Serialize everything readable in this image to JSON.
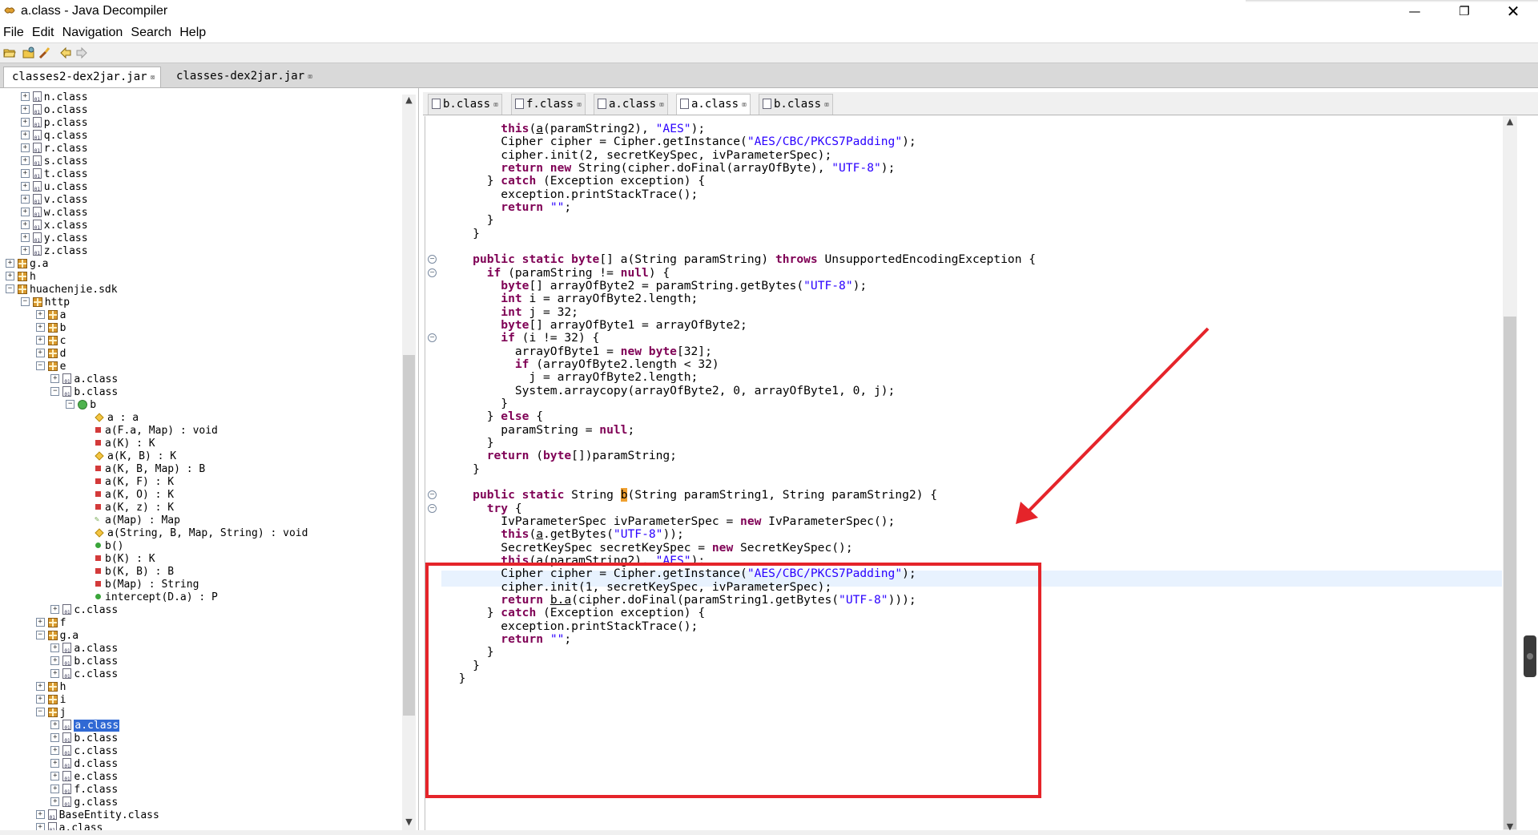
{
  "window": {
    "title": "a.class - Java Decompiler"
  },
  "menu": [
    "File",
    "Edit",
    "Navigation",
    "Search",
    "Help"
  ],
  "toolbar": {
    "icons": [
      "open-file-icon",
      "open-type-icon",
      "search-icon",
      "back-arrow-icon",
      "forward-arrow-icon"
    ]
  },
  "jar_tabs": [
    {
      "label": "classes2-dex2jar.jar",
      "active": true
    },
    {
      "label": "classes-dex2jar.jar",
      "active": false
    }
  ],
  "tree": [
    {
      "label": "n.class",
      "indent": 2,
      "type": "file",
      "exp": "+"
    },
    {
      "label": "o.class",
      "indent": 2,
      "type": "file",
      "exp": "+"
    },
    {
      "label": "p.class",
      "indent": 2,
      "type": "file",
      "exp": "+"
    },
    {
      "label": "q.class",
      "indent": 2,
      "type": "file",
      "exp": "+"
    },
    {
      "label": "r.class",
      "indent": 2,
      "type": "file",
      "exp": "+"
    },
    {
      "label": "s.class",
      "indent": 2,
      "type": "file",
      "exp": "+"
    },
    {
      "label": "t.class",
      "indent": 2,
      "type": "file",
      "exp": "+"
    },
    {
      "label": "u.class",
      "indent": 2,
      "type": "file",
      "exp": "+"
    },
    {
      "label": "v.class",
      "indent": 2,
      "type": "file",
      "exp": "+"
    },
    {
      "label": "w.class",
      "indent": 2,
      "type": "file",
      "exp": "+"
    },
    {
      "label": "x.class",
      "indent": 2,
      "type": "file",
      "exp": "+"
    },
    {
      "label": "y.class",
      "indent": 2,
      "type": "file",
      "exp": "+"
    },
    {
      "label": "z.class",
      "indent": 2,
      "type": "file",
      "exp": "+"
    },
    {
      "label": "g.a",
      "indent": 1,
      "type": "pkg",
      "exp": "+"
    },
    {
      "label": "h",
      "indent": 1,
      "type": "pkg",
      "exp": "+"
    },
    {
      "label": "huachenjie.sdk",
      "indent": 1,
      "type": "pkg",
      "exp": "-"
    },
    {
      "label": "http",
      "indent": 2,
      "type": "pkg",
      "exp": "-"
    },
    {
      "label": "a",
      "indent": 3,
      "type": "pkg",
      "exp": "+"
    },
    {
      "label": "b",
      "indent": 3,
      "type": "pkg",
      "exp": "+"
    },
    {
      "label": "c",
      "indent": 3,
      "type": "pkg",
      "exp": "+"
    },
    {
      "label": "d",
      "indent": 3,
      "type": "pkg",
      "exp": "+"
    },
    {
      "label": "e",
      "indent": 3,
      "type": "pkg",
      "exp": "-"
    },
    {
      "label": "a.class",
      "indent": 4,
      "type": "file",
      "exp": "+"
    },
    {
      "label": "b.class",
      "indent": 4,
      "type": "file",
      "exp": "-"
    },
    {
      "label": "b",
      "indent": 5,
      "type": "class",
      "exp": "-"
    },
    {
      "label": "a : a",
      "indent": 6,
      "type": "diamond",
      "exp": ""
    },
    {
      "label": "a(F.a, Map) : void",
      "indent": 6,
      "type": "red",
      "exp": ""
    },
    {
      "label": "a(K) : K",
      "indent": 6,
      "type": "red",
      "exp": ""
    },
    {
      "label": "a(K, B) : K",
      "indent": 6,
      "type": "diamond",
      "exp": ""
    },
    {
      "label": "a(K, B, Map) : B",
      "indent": 6,
      "type": "red",
      "exp": ""
    },
    {
      "label": "a(K, F) : K",
      "indent": 6,
      "type": "red",
      "exp": ""
    },
    {
      "label": "a(K, O) : K",
      "indent": 6,
      "type": "red",
      "exp": ""
    },
    {
      "label": "a(K, z) : K",
      "indent": 6,
      "type": "red",
      "exp": ""
    },
    {
      "label": "a(Map) : Map",
      "indent": 6,
      "type": "pen",
      "exp": ""
    },
    {
      "label": "a(String, B, Map, String) : void",
      "indent": 6,
      "type": "diamond",
      "exp": ""
    },
    {
      "label": "b()",
      "indent": 6,
      "type": "green",
      "exp": ""
    },
    {
      "label": "b(K) : K",
      "indent": 6,
      "type": "red",
      "exp": ""
    },
    {
      "label": "b(K, B) : B",
      "indent": 6,
      "type": "red",
      "exp": ""
    },
    {
      "label": "b(Map) : String",
      "indent": 6,
      "type": "red",
      "exp": ""
    },
    {
      "label": "intercept(D.a) : P",
      "indent": 6,
      "type": "green",
      "exp": ""
    },
    {
      "label": "c.class",
      "indent": 4,
      "type": "file",
      "exp": "+"
    },
    {
      "label": "f",
      "indent": 3,
      "type": "pkg",
      "exp": "+"
    },
    {
      "label": "g.a",
      "indent": 3,
      "type": "pkg",
      "exp": "-"
    },
    {
      "label": "a.class",
      "indent": 4,
      "type": "file",
      "exp": "+"
    },
    {
      "label": "b.class",
      "indent": 4,
      "type": "file",
      "exp": "+"
    },
    {
      "label": "c.class",
      "indent": 4,
      "type": "file",
      "exp": "+"
    },
    {
      "label": "h",
      "indent": 3,
      "type": "pkg",
      "exp": "+"
    },
    {
      "label": "i",
      "indent": 3,
      "type": "pkg",
      "exp": "+"
    },
    {
      "label": "j",
      "indent": 3,
      "type": "pkg",
      "exp": "-"
    },
    {
      "label": "a.class",
      "indent": 4,
      "type": "file",
      "exp": "+",
      "selected": true
    },
    {
      "label": "b.class",
      "indent": 4,
      "type": "file",
      "exp": "+"
    },
    {
      "label": "c.class",
      "indent": 4,
      "type": "file",
      "exp": "+"
    },
    {
      "label": "d.class",
      "indent": 4,
      "type": "file",
      "exp": "+"
    },
    {
      "label": "e.class",
      "indent": 4,
      "type": "file",
      "exp": "+"
    },
    {
      "label": "f.class",
      "indent": 4,
      "type": "file",
      "exp": "+"
    },
    {
      "label": "g.class",
      "indent": 4,
      "type": "file",
      "exp": "+"
    },
    {
      "label": "BaseEntity.class",
      "indent": 3,
      "type": "file",
      "exp": "+"
    },
    {
      "label": "a.class",
      "indent": 3,
      "type": "file",
      "exp": "+"
    }
  ],
  "editor_tabs": [
    {
      "label": "b.class",
      "active": false
    },
    {
      "label": "f.class",
      "active": false
    },
    {
      "label": "a.class",
      "active": false
    },
    {
      "label": "a.class",
      "active": true
    },
    {
      "label": "b.class",
      "active": false
    }
  ],
  "code_lines": [
    [
      [
        "p",
        "        "
      ],
      [
        "k",
        "this"
      ],
      [
        "p",
        "("
      ],
      [
        "u",
        "a"
      ],
      [
        "p",
        "(paramString2), "
      ],
      [
        "s",
        "\"AES\""
      ],
      [
        "p",
        ");"
      ]
    ],
    [
      [
        "p",
        "        Cipher cipher = Cipher.getInstance("
      ],
      [
        "s",
        "\"AES/CBC/PKCS7Padding\""
      ],
      [
        "p",
        ");"
      ]
    ],
    [
      [
        "p",
        "        cipher.init(2, secretKeySpec, ivParameterSpec);"
      ]
    ],
    [
      [
        "p",
        "        "
      ],
      [
        "k",
        "return new"
      ],
      [
        "p",
        " String(cipher.doFinal(arrayOfByte), "
      ],
      [
        "s",
        "\"UTF-8\""
      ],
      [
        "p",
        ");"
      ]
    ],
    [
      [
        "p",
        "      } "
      ],
      [
        "k",
        "catch"
      ],
      [
        "p",
        " (Exception exception) {"
      ]
    ],
    [
      [
        "p",
        "        exception.printStackTrace();"
      ]
    ],
    [
      [
        "p",
        "        "
      ],
      [
        "k",
        "return"
      ],
      [
        "p",
        " "
      ],
      [
        "s",
        "\"\""
      ],
      [
        "p",
        ";"
      ]
    ],
    [
      [
        "p",
        "      }"
      ]
    ],
    [
      [
        "p",
        "    }"
      ]
    ],
    [
      [
        "p",
        ""
      ]
    ],
    [
      [
        "p",
        "    "
      ],
      [
        "k",
        "public static byte"
      ],
      [
        "p",
        "[] a(String paramString) "
      ],
      [
        "k",
        "throws"
      ],
      [
        "p",
        " UnsupportedEncodingException {"
      ]
    ],
    [
      [
        "p",
        "      "
      ],
      [
        "k",
        "if"
      ],
      [
        "p",
        " (paramString != "
      ],
      [
        "k",
        "null"
      ],
      [
        "p",
        ") {"
      ]
    ],
    [
      [
        "p",
        "        "
      ],
      [
        "k",
        "byte"
      ],
      [
        "p",
        "[] arrayOfByte2 = paramString.getBytes("
      ],
      [
        "s",
        "\"UTF-8\""
      ],
      [
        "p",
        ");"
      ]
    ],
    [
      [
        "p",
        "        "
      ],
      [
        "k",
        "int"
      ],
      [
        "p",
        " i = arrayOfByte2.length;"
      ]
    ],
    [
      [
        "p",
        "        "
      ],
      [
        "k",
        "int"
      ],
      [
        "p",
        " j = 32;"
      ]
    ],
    [
      [
        "p",
        "        "
      ],
      [
        "k",
        "byte"
      ],
      [
        "p",
        "[] arrayOfByte1 = arrayOfByte2;"
      ]
    ],
    [
      [
        "p",
        "        "
      ],
      [
        "k",
        "if"
      ],
      [
        "p",
        " (i != 32) {"
      ]
    ],
    [
      [
        "p",
        "          arrayOfByte1 = "
      ],
      [
        "k",
        "new byte"
      ],
      [
        "p",
        "[32];"
      ]
    ],
    [
      [
        "p",
        "          "
      ],
      [
        "k",
        "if"
      ],
      [
        "p",
        " (arrayOfByte2.length < 32)"
      ]
    ],
    [
      [
        "p",
        "            j = arrayOfByte2.length;"
      ]
    ],
    [
      [
        "p",
        "          System.arraycopy(arrayOfByte2, 0, arrayOfByte1, 0, j);"
      ]
    ],
    [
      [
        "p",
        "        }"
      ]
    ],
    [
      [
        "p",
        "      } "
      ],
      [
        "k",
        "else"
      ],
      [
        "p",
        " {"
      ]
    ],
    [
      [
        "p",
        "        paramString = "
      ],
      [
        "k",
        "null"
      ],
      [
        "p",
        ";"
      ]
    ],
    [
      [
        "p",
        "      }"
      ]
    ],
    [
      [
        "p",
        "      "
      ],
      [
        "k",
        "return"
      ],
      [
        "p",
        " ("
      ],
      [
        "k",
        "byte"
      ],
      [
        "p",
        "[])paramString;"
      ]
    ],
    [
      [
        "p",
        "    }"
      ]
    ],
    [
      [
        "p",
        ""
      ]
    ],
    [
      [
        "p",
        "    "
      ],
      [
        "k",
        "public static"
      ],
      [
        "p",
        " String "
      ],
      [
        "c",
        "b"
      ],
      [
        "p",
        "(String paramString1, String paramString2) {"
      ]
    ],
    [
      [
        "p",
        "      "
      ],
      [
        "k",
        "try"
      ],
      [
        "p",
        " {"
      ]
    ],
    [
      [
        "p",
        "        IvParameterSpec ivParameterSpec = "
      ],
      [
        "k",
        "new"
      ],
      [
        "p",
        " IvParameterSpec();"
      ]
    ],
    [
      [
        "p",
        "        "
      ],
      [
        "k",
        "this"
      ],
      [
        "p",
        "("
      ],
      [
        "u",
        "a"
      ],
      [
        "p",
        ".getBytes("
      ],
      [
        "s",
        "\"UTF-8\""
      ],
      [
        "p",
        "));"
      ]
    ],
    [
      [
        "p",
        "        SecretKeySpec secretKeySpec = "
      ],
      [
        "k",
        "new"
      ],
      [
        "p",
        " SecretKeySpec();"
      ]
    ],
    [
      [
        "p",
        "        "
      ],
      [
        "k",
        "this"
      ],
      [
        "p",
        "("
      ],
      [
        "u",
        "a"
      ],
      [
        "p",
        "(paramString2), "
      ],
      [
        "s",
        "\"AES\""
      ],
      [
        "p",
        ");"
      ]
    ],
    [
      [
        "p",
        "        Cipher cipher = Cipher.getInstance("
      ],
      [
        "s",
        "\"AES/CBC/PKCS7Padding\""
      ],
      [
        "p",
        ");"
      ]
    ],
    [
      [
        "p",
        "        cipher.init(1, secretKeySpec, ivParameterSpec);"
      ]
    ],
    [
      [
        "p",
        "        "
      ],
      [
        "k",
        "return"
      ],
      [
        "p",
        " "
      ],
      [
        "u",
        "b.a"
      ],
      [
        "p",
        "(cipher.doFinal(paramString1.getBytes("
      ],
      [
        "s",
        "\"UTF-8\""
      ],
      [
        "p",
        ")));"
      ]
    ],
    [
      [
        "p",
        "      } "
      ],
      [
        "k",
        "catch"
      ],
      [
        "p",
        " (Exception exception) {"
      ]
    ],
    [
      [
        "p",
        "        exception.printStackTrace();"
      ]
    ],
    [
      [
        "p",
        "        "
      ],
      [
        "k",
        "return"
      ],
      [
        "p",
        " "
      ],
      [
        "s",
        "\"\""
      ],
      [
        "p",
        ";"
      ]
    ],
    [
      [
        "p",
        "      }"
      ]
    ],
    [
      [
        "p",
        "    }"
      ]
    ],
    [
      [
        "p",
        "  }"
      ]
    ]
  ],
  "fold_markers": [
    10,
    11,
    16,
    28,
    29
  ],
  "colors": {
    "keyword": "#7f0055",
    "string": "#2a00ff",
    "highlight_box": "#e5242a",
    "selection": "#3069d4"
  }
}
